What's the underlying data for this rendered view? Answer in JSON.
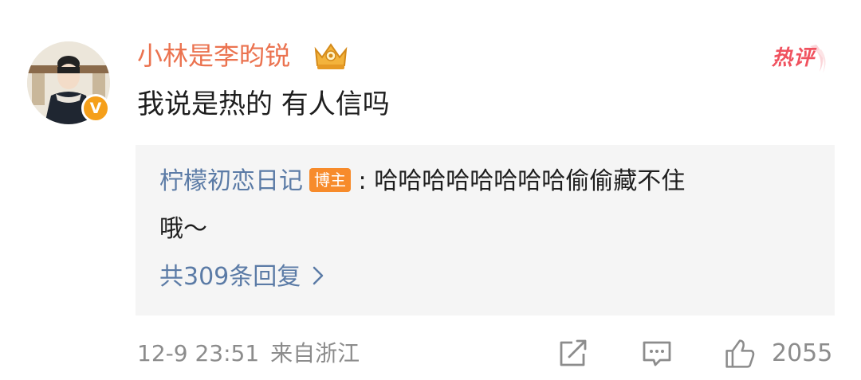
{
  "comment": {
    "username": "小林是李昀锐",
    "text": "我说是热的 有人信吗",
    "hot_label": "热评",
    "verified_badge": "V",
    "icons": {
      "avatar": "avatar-icon",
      "verified": "verified-badge-icon",
      "crown": "vip-crown-icon",
      "hot": "hot-comment-icon"
    }
  },
  "reply": {
    "username": "柠檬初恋日记",
    "author_badge": "博主",
    "separator": ":",
    "text_line1": "哈哈哈哈哈哈哈哈偷偷藏不住",
    "text_line2": "哦～",
    "view_all": "共309条回复",
    "chevron_icon": "chevron-right-icon"
  },
  "footer": {
    "time": "12-9 23:51",
    "location": "来自浙江",
    "like_count": "2055",
    "icons": [
      "share-icon",
      "comment-icon",
      "like-icon"
    ]
  },
  "colors": {
    "username": "#eb7350",
    "link": "#5b7ba6",
    "hot": "#f0525f",
    "badge_orange": "#f78b2b",
    "muted": "#8c8c8c",
    "reply_bg": "#f5f5f5"
  }
}
